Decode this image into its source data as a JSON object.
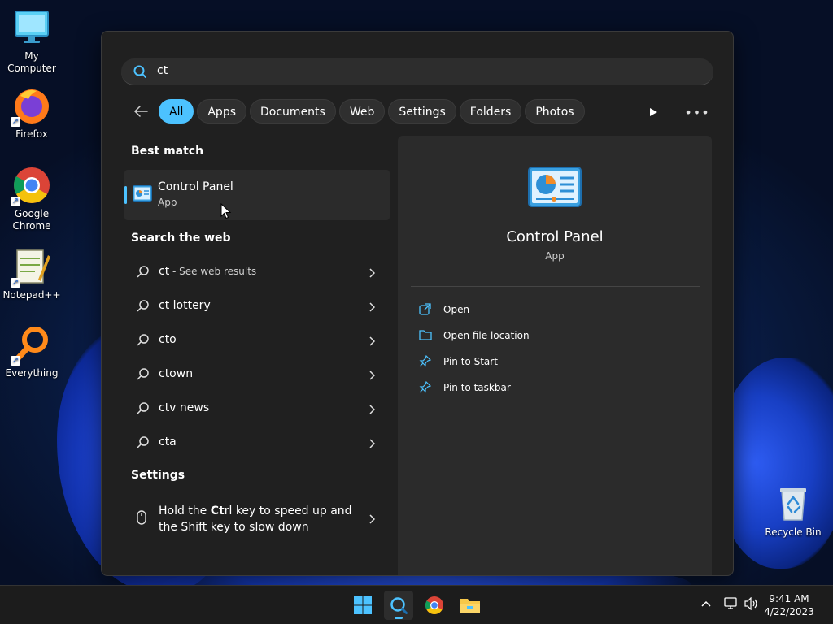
{
  "desktop": {
    "icons": [
      {
        "label": "My Computer",
        "icon": "monitor-icon"
      },
      {
        "label": "Firefox",
        "icon": "firefox-icon"
      },
      {
        "label": "Google Chrome",
        "icon": "chrome-icon"
      },
      {
        "label": "Notepad++",
        "icon": "notepad-plus-plus-icon"
      },
      {
        "label": "Everything",
        "icon": "everything-search-icon"
      },
      {
        "label": "Recycle Bin",
        "icon": "recycle-bin-icon"
      }
    ]
  },
  "search": {
    "query": "ct",
    "filters": [
      "All",
      "Apps",
      "Documents",
      "Web",
      "Settings",
      "Folders",
      "Photos"
    ],
    "active_filter": "All"
  },
  "results": {
    "best_match_title": "Best match",
    "best_match": {
      "name": "Control Panel",
      "type": "App"
    },
    "web_title": "Search the web",
    "web_items": [
      {
        "query": "ct",
        "suffix": " - See web results"
      },
      {
        "query": "ct lottery",
        "suffix": ""
      },
      {
        "query": "cto",
        "suffix": ""
      },
      {
        "query": "ctown",
        "suffix": ""
      },
      {
        "query": "ctv news",
        "suffix": ""
      },
      {
        "query": "cta",
        "suffix": ""
      }
    ],
    "settings_title": "Settings",
    "settings_item": {
      "pre": "Hold the ",
      "bold": "Ct",
      "post": "rl key to speed up and the Shift key to slow down"
    }
  },
  "preview": {
    "name": "Control Panel",
    "type": "App",
    "actions": [
      {
        "label": "Open",
        "icon": "open-external-icon"
      },
      {
        "label": "Open file location",
        "icon": "folder-icon"
      },
      {
        "label": "Pin to Start",
        "icon": "pin-icon"
      },
      {
        "label": "Pin to taskbar",
        "icon": "pin-icon"
      }
    ]
  },
  "taskbar": {
    "time": "9:41 AM",
    "date": "4/22/2023"
  },
  "colors": {
    "accent": "#4cc2ff",
    "panel_bg": "#202020",
    "taskbar_bg": "#1c1c1c"
  }
}
